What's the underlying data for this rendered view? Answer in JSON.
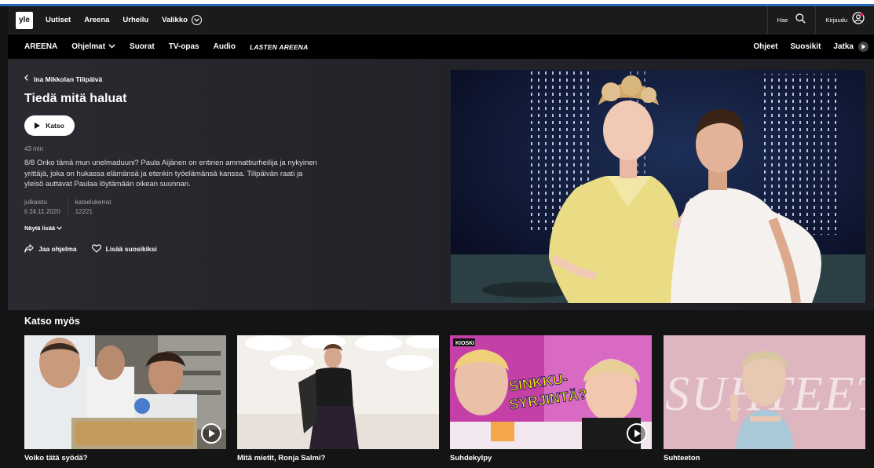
{
  "yle_nav": {
    "logo": "yle",
    "links": [
      "Uutiset",
      "Areena",
      "Urheilu"
    ],
    "menu_label": "Valikko",
    "search_label": "Hae",
    "login_label": "Kirjaudu"
  },
  "areena_nav": {
    "brand": "AREENA",
    "programs": "Ohjelmat",
    "items": [
      "Suorat",
      "TV-opas",
      "Audio"
    ],
    "kids": "LASTEN AREENA",
    "right_items": [
      "Ohjeet",
      "Suosikit"
    ],
    "continue_label": "Jatka"
  },
  "hero": {
    "back_label": "Ina Mikkolan Tilipäivä",
    "title": "Tiedä mitä haluat",
    "play_label": "Katso",
    "duration": "43 min",
    "description": "8/8 Onko tämä mun unelmaduuni? Paula Aijänen on entinen ammattiurheilija ja nykyinen yrittäjä, joka on hukassa elämänsä ja etenkin työelämänsä kanssa. Tilipäivän raati ja yleisö auttavat Paulaa löytämään oikean suunnan.",
    "published_label": "julkaistu",
    "published_value": "ti 24.11.2020",
    "views_label": "katselukerrat",
    "views_value": "12221",
    "show_more": "Näytä lisää",
    "share_label": "Jaa ohjelma",
    "favorite_label": "Lisää suosikiksi"
  },
  "see_also": {
    "title": "Katso myös",
    "cards": [
      {
        "label": "Voiko tätä syödä?"
      },
      {
        "label": "Mitä mietit, Ronja Salmi?"
      },
      {
        "label": "Suhdekylpy",
        "overlay_lines": [
          "SINKKU-",
          "SYRJINTÄ?"
        ],
        "corner": "KIOSKI"
      },
      {
        "label": "Suhteeton",
        "overlay": "SUHTEETON"
      }
    ]
  },
  "colors": {
    "accent": "#2a66b8",
    "nav_bg": "#1b1b1b",
    "areena_bg": "#000000",
    "hero_bg": "#2a2a30"
  }
}
